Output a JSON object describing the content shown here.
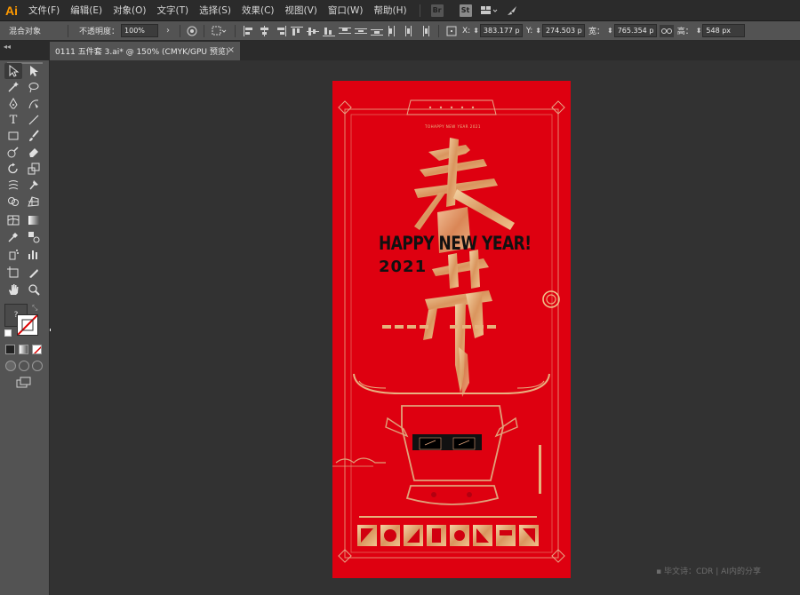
{
  "app": {
    "logo": "Ai",
    "menus": [
      "文件(F)",
      "编辑(E)",
      "对象(O)",
      "文字(T)",
      "选择(S)",
      "效果(C)",
      "视图(V)",
      "窗口(W)",
      "帮助(H)"
    ],
    "bridge_label": "Br",
    "stock_label": "St"
  },
  "controlbar": {
    "selection_type": "混合对象",
    "opacity_label": "不透明度：",
    "opacity_value": "100%",
    "x_label": "X:",
    "x_value": "383.177 p",
    "y_label": "Y:",
    "y_value": "274.503 p",
    "width_label": "宽：",
    "width_value": "765.354 p",
    "height_label": "高：",
    "height_value": "548 px"
  },
  "document": {
    "tab_title": "0111 五件套 3.ai* @ 150% (CMYK/GPU 预览)"
  },
  "artwork": {
    "headline": "HAPPY NEW YEAR!",
    "year": "2021",
    "top_small": "TOHAPPY NEW YEAR 2021"
  },
  "watermark": "▪ 毕文诗：CDR | AI内的分享",
  "colors": {
    "artboard_red": "#de0010",
    "gold": "#e7b07a"
  }
}
